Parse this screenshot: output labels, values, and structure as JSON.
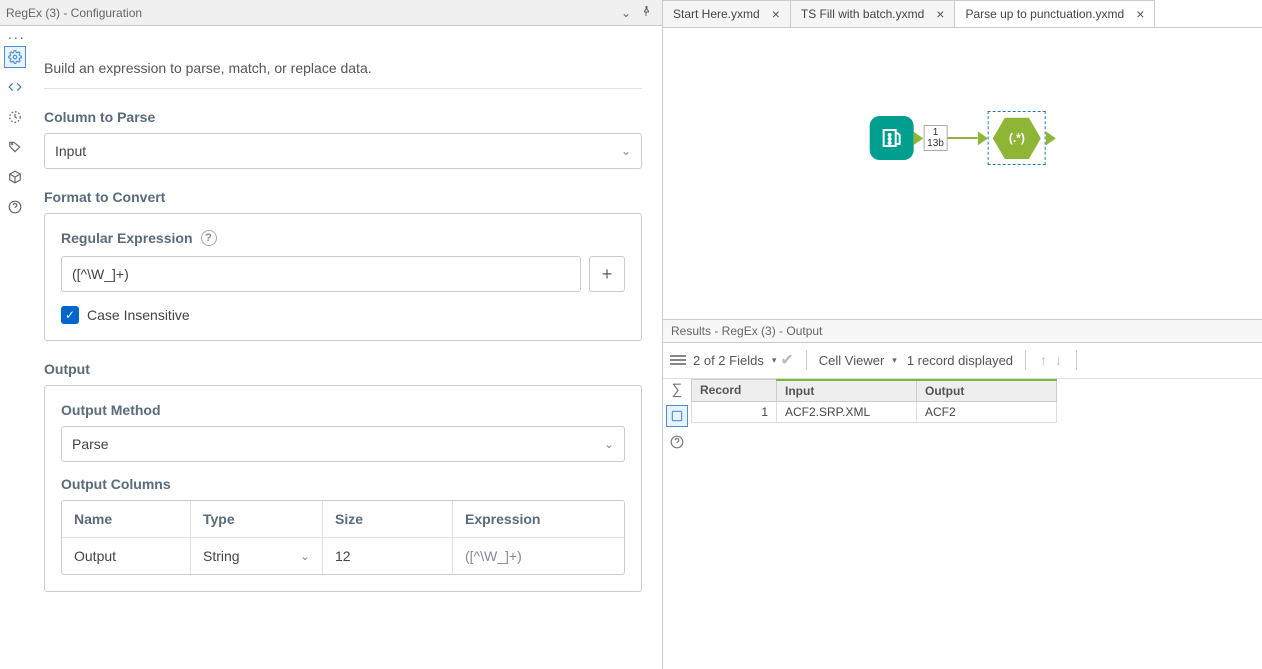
{
  "panel": {
    "title": "RegEx (3) - Configuration",
    "description": "Build an expression to parse, match, or replace data.",
    "column_to_parse_label": "Column to Parse",
    "column_to_parse_value": "Input",
    "format_to_convert_label": "Format to Convert",
    "regex_label": "Regular Expression",
    "regex_value": "([^\\W_]+)",
    "case_insensitive_label": "Case Insensitive",
    "output_label": "Output",
    "output_method_label": "Output Method",
    "output_method_value": "Parse",
    "output_columns_label": "Output Columns",
    "outcols": {
      "headers": {
        "name": "Name",
        "type": "Type",
        "size": "Size",
        "expr": "Expression"
      },
      "rows": [
        {
          "name": "Output",
          "type": "String",
          "size": "12",
          "expr": "([^\\W_]+)"
        }
      ]
    }
  },
  "tabs": [
    {
      "label": "Start Here.yxmd",
      "active": false
    },
    {
      "label": "TS Fill with batch.yxmd",
      "active": false
    },
    {
      "label": "Parse up to punctuation.yxmd",
      "active": true
    }
  ],
  "canvas": {
    "record_badge_top": "1",
    "record_badge_bottom": "13b",
    "regex_node_label": "(.*)"
  },
  "results": {
    "title": "Results - RegEx (3) - Output",
    "fields_text": "2 of 2 Fields",
    "cell_viewer": "Cell Viewer",
    "records_text": "1 record displayed",
    "columns": [
      "Record",
      "Input",
      "Output"
    ],
    "rows": [
      {
        "record": "1",
        "input": "ACF2.SRP.XML",
        "output": "ACF2"
      }
    ]
  }
}
